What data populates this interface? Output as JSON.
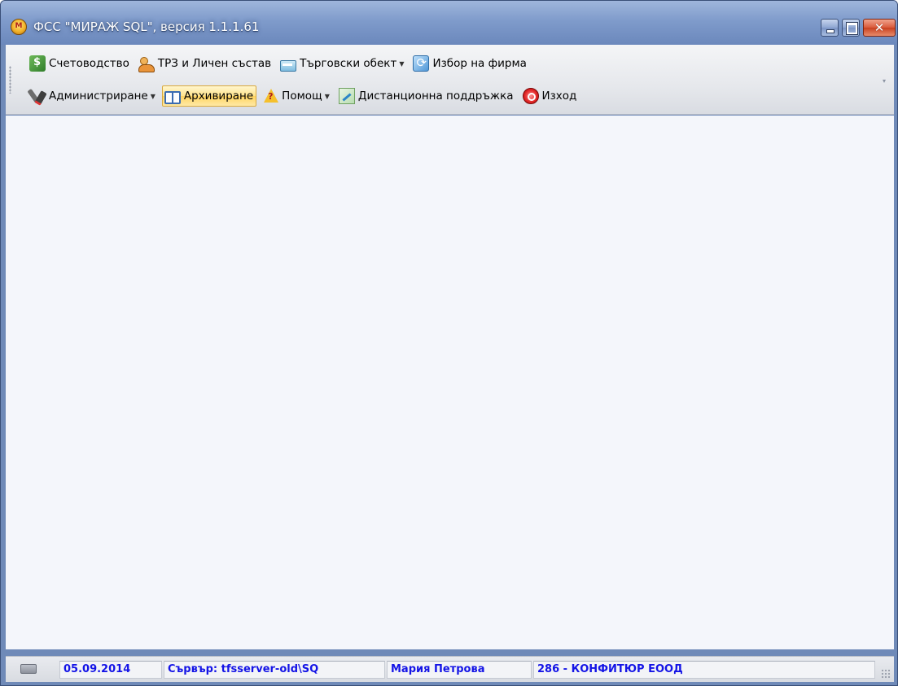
{
  "window": {
    "title": "ФСС \"МИРАЖ SQL\", версия 1.1.1.61",
    "close_glyph": "✕"
  },
  "toolbar": {
    "row1": [
      {
        "label": "Счетоводство",
        "icon": "accounting-icon"
      },
      {
        "label": "ТРЗ и Личен състав",
        "icon": "staff-icon"
      },
      {
        "label": "Търговски обект",
        "icon": "store-icon",
        "dropdown": true
      },
      {
        "label": "Избор на фирма",
        "icon": "firm-select-icon"
      }
    ],
    "row2": [
      {
        "label": "Администриране",
        "icon": "admin-tools-icon",
        "dropdown": true
      },
      {
        "label": "Архивиране",
        "icon": "archive-book-icon",
        "active": true
      },
      {
        "label": "Помощ",
        "icon": "help-icon",
        "dropdown": true
      },
      {
        "label": "Дистанционна поддръжка",
        "icon": "remote-support-icon"
      },
      {
        "label": "Изход",
        "icon": "exit-icon"
      }
    ],
    "dropdown_arrow": "▼",
    "overflow_arrow": "▾"
  },
  "statusbar": {
    "date": "05.09.2014",
    "server": "Сървър: tfsserver-old\\SQ",
    "user": "Мария Петрова",
    "company": "286 - КОНФИТЮР ЕООД"
  },
  "colors": {
    "titlebar": "#7f9bcb",
    "status_text": "#1414e6",
    "active_button": "#ffd460"
  }
}
